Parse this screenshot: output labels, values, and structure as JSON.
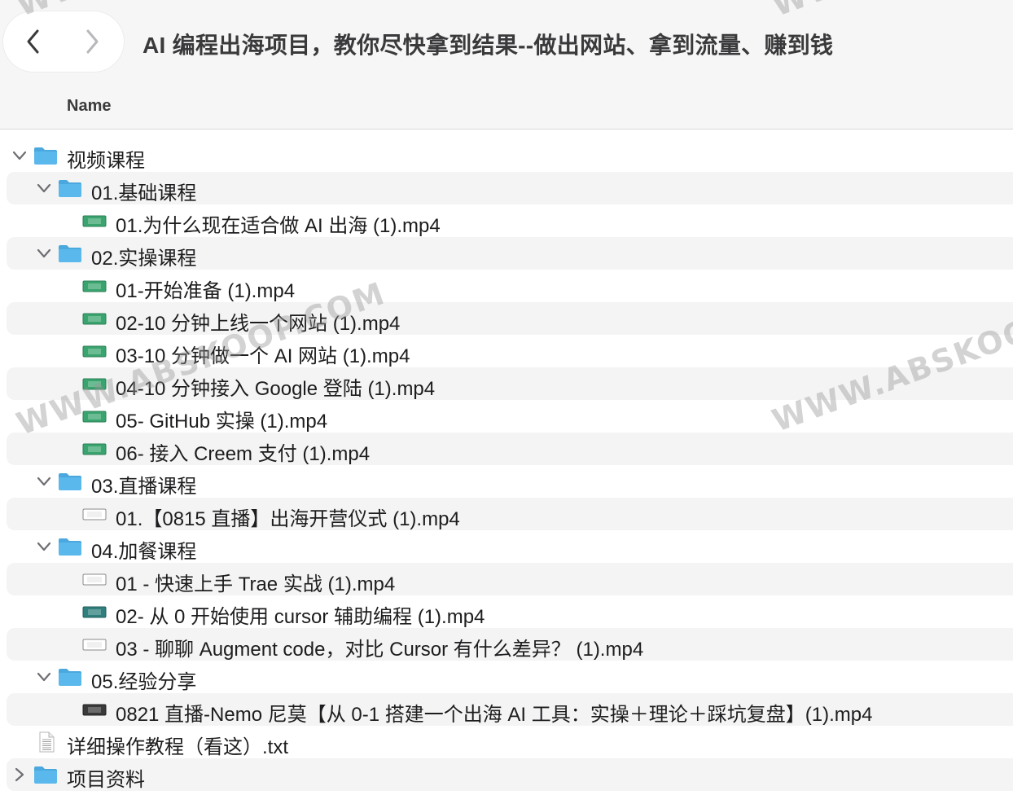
{
  "window": {
    "title": "AI 编程出海项目，教你尽快拿到结果--做出网站、拿到流量、赚到钱"
  },
  "columns": {
    "name": "Name"
  },
  "rows": [
    {
      "label": "视频课程",
      "kind": "folder",
      "depth": 0,
      "expanded": true
    },
    {
      "label": "01.基础课程",
      "kind": "folder",
      "depth": 1,
      "expanded": true
    },
    {
      "label": "01.为什么现在适合做 AI 出海 (1).mp4",
      "kind": "video",
      "depth": 2
    },
    {
      "label": "02.实操课程",
      "kind": "folder",
      "depth": 1,
      "expanded": true
    },
    {
      "label": "01-开始准备 (1).mp4",
      "kind": "video",
      "depth": 2
    },
    {
      "label": "02-10 分钟上线一个网站 (1).mp4",
      "kind": "video",
      "depth": 2
    },
    {
      "label": "03-10 分钟做一个 AI 网站 (1).mp4",
      "kind": "video",
      "depth": 2
    },
    {
      "label": "04-10 分钟接入 Google 登陆 (1).mp4",
      "kind": "video",
      "depth": 2
    },
    {
      "label": "05- GitHub 实操 (1).mp4",
      "kind": "video",
      "depth": 2
    },
    {
      "label": "06- 接入 Creem 支付 (1).mp4",
      "kind": "video",
      "depth": 2
    },
    {
      "label": "03.直播课程",
      "kind": "folder",
      "depth": 1,
      "expanded": true
    },
    {
      "label": "01.【0815 直播】出海开营仪式 (1).mp4",
      "kind": "video-light",
      "depth": 2
    },
    {
      "label": "04.加餐课程",
      "kind": "folder",
      "depth": 1,
      "expanded": true
    },
    {
      "label": "01 - 快速上手 Trae 实战 (1).mp4",
      "kind": "video-light",
      "depth": 2
    },
    {
      "label": "02- 从 0 开始使用 cursor 辅助编程 (1).mp4",
      "kind": "video-teal",
      "depth": 2
    },
    {
      "label": "03 - 聊聊 Augment code，对比 Cursor 有什么差异？ (1).mp4",
      "kind": "video-light",
      "depth": 2
    },
    {
      "label": "05.经验分享",
      "kind": "folder",
      "depth": 1,
      "expanded": true
    },
    {
      "label": "0821 直播-Nemo 尼莫【从 0-1 搭建一个出海 AI 工具：实操＋理论＋踩坑复盘】(1).mp4",
      "kind": "video-dark",
      "depth": 2
    },
    {
      "label": "详细操作教程（看这）.txt",
      "kind": "text",
      "depth": 0
    },
    {
      "label": "项目资料",
      "kind": "folder",
      "depth": 0,
      "expanded": false
    }
  ],
  "watermark": {
    "text": "WWW.ABSKOOP.COM",
    "color": "#969696"
  },
  "colors": {
    "folder": "#5ab8ec",
    "folder_tab": "#4aa8de",
    "video_green": "#3aa46f",
    "video_teal": "#2f7f7c",
    "video_dark": "#3a3a3a",
    "chevron": "#6e6e73"
  },
  "icons": {
    "back": "chevron-left-icon",
    "forward": "chevron-right-icon",
    "folder": "folder-icon",
    "video": "video-file-icon",
    "text": "text-document-icon"
  }
}
